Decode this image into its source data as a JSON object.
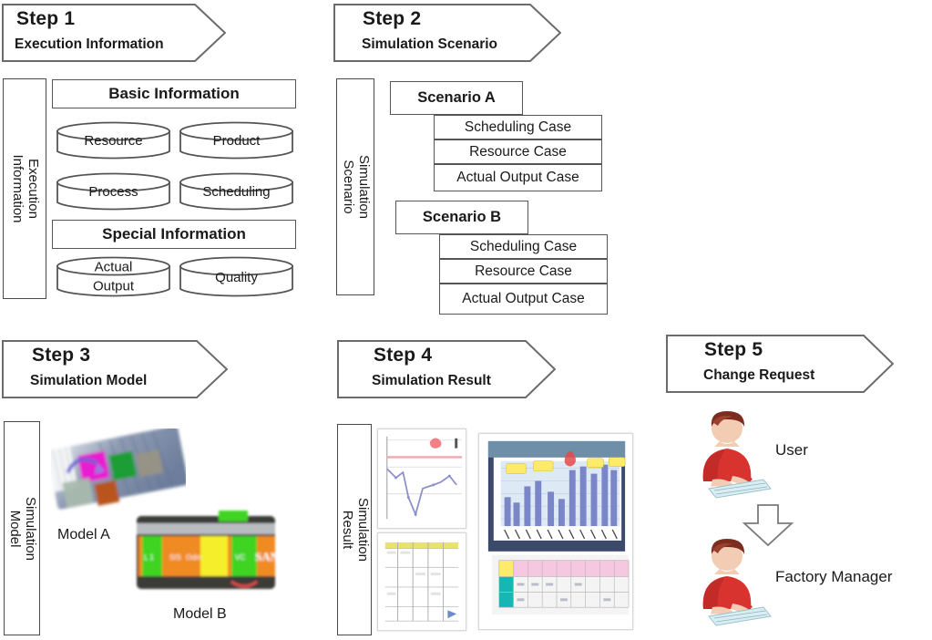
{
  "diagram": {
    "title": "Five-step simulation workflow",
    "colors": {
      "outline": "#555555",
      "banner_outline": "#6b6b6b",
      "shirt_red": "#d8332f",
      "hair_brown": "#7c2d20",
      "skin": "#f2cdb4",
      "chart_blue": "#7b86c8",
      "callout_yellow": "#ffeb6b",
      "table_pink": "#f6c7e0",
      "table_teal": "#18b5b5",
      "model_orange": "#f08a22",
      "model_green": "#3fd420",
      "model_yellow": "#f5ee2a",
      "model_magenta": "#e81fd0"
    }
  },
  "steps": [
    {
      "id": "step1",
      "number": "Step 1",
      "subtitle": "Execution Information",
      "side_label_line1": "Execution",
      "side_label_line2": "Information"
    },
    {
      "id": "step2",
      "number": "Step 2",
      "subtitle": "Simulation Scenario",
      "side_label_line1": "Simulation",
      "side_label_line2": "Scenario"
    },
    {
      "id": "step3",
      "number": "Step 3",
      "subtitle": "Simulation Model",
      "side_label_line1": "Simulation",
      "side_label_line2": "Model"
    },
    {
      "id": "step4",
      "number": "Step 4",
      "subtitle": "Simulation Result",
      "side_label_line1": "Simulation",
      "side_label_line2": "Result"
    },
    {
      "id": "step5",
      "number": "Step 5",
      "subtitle": "Change Request",
      "side_label_line1": "",
      "side_label_line2": ""
    }
  ],
  "step1": {
    "basic_information": "Basic Information",
    "special_information": "Special Information",
    "basic_items": [
      {
        "label": "Resource"
      },
      {
        "label": "Product"
      },
      {
        "label": "Process"
      },
      {
        "label": "Scheduling"
      }
    ],
    "special_items": [
      {
        "label_line1": "Actual",
        "label_line2": "Output"
      },
      {
        "label_line1": "Quality",
        "label_line2": ""
      }
    ]
  },
  "step2": {
    "scenarios": [
      {
        "name": "Scenario A",
        "cases": [
          "Scheduling Case",
          "Resource Case",
          "Actual Output Case"
        ]
      },
      {
        "name": "Scenario B",
        "cases": [
          "Scheduling Case",
          "Resource Case",
          "Actual Output Case"
        ]
      }
    ]
  },
  "step3": {
    "models": [
      {
        "caption": "Model A"
      },
      {
        "caption": "Model B"
      }
    ]
  },
  "step4": {
    "thumbnails": [
      {
        "kind": "line-chart"
      },
      {
        "kind": "data-table"
      },
      {
        "kind": "bar-chart-dashboard"
      }
    ]
  },
  "step5": {
    "actors": [
      {
        "label": "User"
      },
      {
        "label": "Factory Manager"
      }
    ],
    "flow_arrow": "down-arrow"
  }
}
